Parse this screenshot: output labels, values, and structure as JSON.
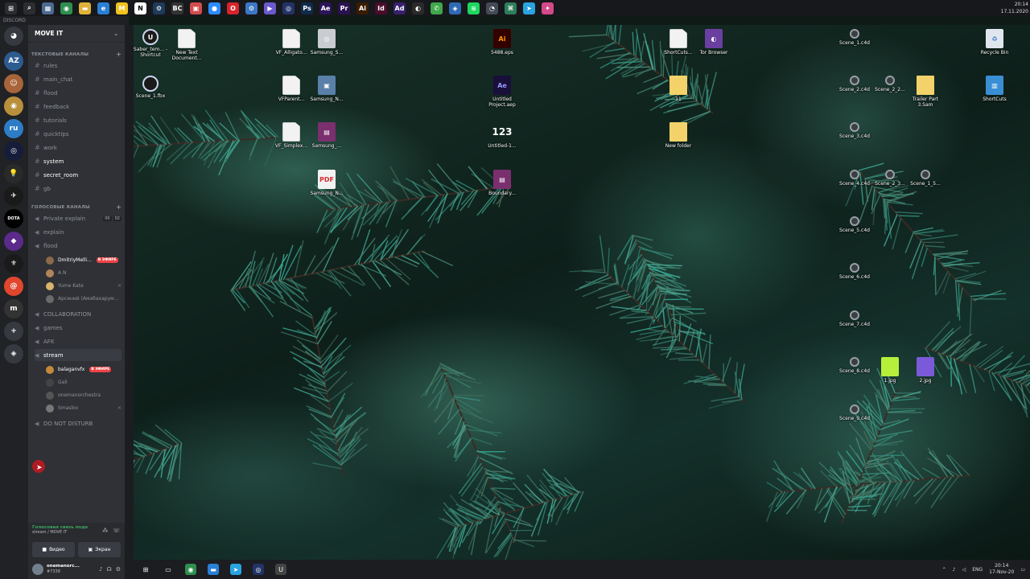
{
  "top_taskbar": {
    "icons": [
      {
        "name": "windows-start-icon",
        "color": "#2b2d31",
        "glyph": "⊞"
      },
      {
        "name": "search-icon",
        "color": "#2b2d31",
        "glyph": "⌕"
      },
      {
        "name": "calculator-icon",
        "color": "#4b6a90",
        "glyph": "▦"
      },
      {
        "name": "chrome-icon",
        "color": "#2f8f4e",
        "glyph": "◉"
      },
      {
        "name": "explorer-icon",
        "color": "#e0b23a",
        "glyph": "▬"
      },
      {
        "name": "edge-icon",
        "color": "#2a7fd4",
        "glyph": "e"
      },
      {
        "name": "miro-icon",
        "color": "#f3c21d",
        "glyph": "M"
      },
      {
        "name": "notion-icon",
        "color": "#ffffff",
        "glyph": "N"
      },
      {
        "name": "steam-icon",
        "color": "#1f3b5a",
        "glyph": "⚙"
      },
      {
        "name": "bc-icon",
        "color": "#333333",
        "glyph": "BC"
      },
      {
        "name": "app-red-icon",
        "color": "#d24c4c",
        "glyph": "▣"
      },
      {
        "name": "zoom-icon",
        "color": "#2d8cff",
        "glyph": "●"
      },
      {
        "name": "opera-icon",
        "color": "#d8242b",
        "glyph": "O"
      },
      {
        "name": "settings-icon",
        "color": "#3a78c4",
        "glyph": "⚙"
      },
      {
        "name": "play-icon",
        "color": "#6a5acd",
        "glyph": "▶"
      },
      {
        "name": "cinema4d-icon",
        "color": "#223366",
        "glyph": "◎"
      },
      {
        "name": "photoshop-icon",
        "color": "#0f2a4a",
        "glyph": "Ps"
      },
      {
        "name": "aftereffects-icon",
        "color": "#2b145a",
        "glyph": "Ae"
      },
      {
        "name": "premiere-icon",
        "color": "#2a1252",
        "glyph": "Pr"
      },
      {
        "name": "illustrator-icon",
        "color": "#3b1c00",
        "glyph": "Ai"
      },
      {
        "name": "indesign-icon",
        "color": "#4a0d2a",
        "glyph": "Id"
      },
      {
        "name": "adobe-icon",
        "color": "#38216e",
        "glyph": "Ad"
      },
      {
        "name": "obs-icon",
        "color": "#2a2a2a",
        "glyph": "◐"
      },
      {
        "name": "whatsapp-icon",
        "color": "#3ea84a",
        "glyph": "✆"
      },
      {
        "name": "app-blue-icon",
        "color": "#2f6ab6",
        "glyph": "◈"
      },
      {
        "name": "spotify-icon",
        "color": "#1ed760",
        "glyph": "≋"
      },
      {
        "name": "discord-taskbar-icon",
        "color": "#444a55",
        "glyph": "◔"
      },
      {
        "name": "app-grid-icon",
        "color": "#2e7d5b",
        "glyph": "⌘"
      },
      {
        "name": "telegram-icon",
        "color": "#2aa3e0",
        "glyph": "➤"
      },
      {
        "name": "app-multicolor-icon",
        "color": "#d34a8a",
        "glyph": "✦"
      }
    ],
    "clock_time": "20:14",
    "clock_date": "17.11.2020"
  },
  "discord": {
    "window_title": "DISCORD",
    "guild_name": "MOVE IT",
    "text_category": "ТЕКСТОВЫЕ КАНАЛЫ",
    "text_channels": [
      {
        "name": "rules",
        "unread": false
      },
      {
        "name": "main_chat",
        "unread": false
      },
      {
        "name": "flood",
        "unread": false
      },
      {
        "name": "feedback",
        "unread": false
      },
      {
        "name": "tutorials",
        "unread": false
      },
      {
        "name": "quicktips",
        "unread": false
      },
      {
        "name": "work",
        "unread": false
      },
      {
        "name": "system",
        "unread": true
      },
      {
        "name": "secret_room",
        "unread": true
      },
      {
        "name": "gb",
        "unread": false
      }
    ],
    "voice_category": "ГОЛОСОВЫЕ КАНАЛЫ",
    "voice_channels": [
      {
        "name": "Private explain",
        "counts": [
          "00",
          "02"
        ]
      },
      {
        "name": "explain"
      },
      {
        "name": "flood"
      },
      {
        "name": "COLLABORATION"
      },
      {
        "name": "games"
      },
      {
        "name": "AFK"
      },
      {
        "name": "stream"
      },
      {
        "name": "DO NOT DISTURB"
      }
    ],
    "flood_users": [
      {
        "name": "DmitriyMelli...",
        "live": "В ЭФИРЕ",
        "color": "#8a6a4a"
      },
      {
        "name": "A N",
        "color": "#b0845c"
      },
      {
        "name": "Yume Kate",
        "mic": "✕",
        "color": "#d9b36a"
      },
      {
        "name": "Арсений (Амабахарум...",
        "color": "#6a6a6a"
      }
    ],
    "stream_users": [
      {
        "name": "balaganvfx",
        "live": "В ЭФИРЕ",
        "color": "#c48a3a"
      },
      {
        "name": "Gali",
        "color": "#444444"
      },
      {
        "name": "onemanorchestra",
        "color": "#555555"
      },
      {
        "name": "Smaslov",
        "mic": "✕",
        "color": "#777777"
      }
    ],
    "voice_status_title": "Голосовая связь подк",
    "voice_status_sub": "stream / MOVE IT",
    "video_label": "Видео",
    "screen_label": "Экран",
    "user_name": "onemanorc...",
    "user_tag": "#7338",
    "servers": [
      {
        "name": "server-home",
        "glyph": "◕",
        "color": "#36393f"
      },
      {
        "name": "server-az",
        "glyph": "AZ",
        "color": "#2c5b8f"
      },
      {
        "name": "server-avatar",
        "glyph": "☺",
        "color": "#a8643a"
      },
      {
        "name": "server-gold",
        "glyph": "◉",
        "color": "#b88f3c"
      },
      {
        "name": "server-ru",
        "glyph": "ru",
        "color": "#2d7cc6"
      },
      {
        "name": "server-c4d",
        "glyph": "◎",
        "color": "#151d3a"
      },
      {
        "name": "server-bulb",
        "glyph": "💡",
        "color": "#2a2a2a"
      },
      {
        "name": "server-bird",
        "glyph": "✈",
        "color": "#1a1a1a"
      },
      {
        "name": "server-dota",
        "glyph": "DOTA",
        "color": "#000000"
      },
      {
        "name": "server-purple",
        "glyph": "◆",
        "color": "#5b2a8a"
      },
      {
        "name": "server-symbol",
        "glyph": "⚜",
        "color": "#1a1a1a"
      },
      {
        "name": "server-houdini",
        "glyph": "@",
        "color": "#e0472e"
      },
      {
        "name": "server-m",
        "glyph": "m",
        "color": "#333333"
      },
      {
        "name": "server-add",
        "glyph": "+",
        "color": "#36393f"
      },
      {
        "name": "server-explore",
        "glyph": "◈",
        "color": "#36393f"
      }
    ]
  },
  "desktop": {
    "icons": [
      {
        "name": "Saber_tem... - Shortcut",
        "kind": "ue"
      },
      {
        "name": "New Text Document...",
        "kind": "doc"
      },
      {
        "name": "Scene_1.fbx",
        "kind": "c4d"
      },
      {
        "name": "VF_Alligato...",
        "kind": "doc"
      },
      {
        "name": "Samsung_S...",
        "kind": "disk"
      },
      {
        "name": "VFParent...",
        "kind": "doc"
      },
      {
        "name": "Samsung_N...",
        "kind": "pc"
      },
      {
        "name": "VF_Simplex...",
        "kind": "doc"
      },
      {
        "name": "Samsung_...",
        "kind": "rar"
      },
      {
        "name": "Samsung_N...",
        "kind": "pdf"
      },
      {
        "name": "5488.eps",
        "kind": "ai"
      },
      {
        "name": "Untitled Project.aep",
        "kind": "ae"
      },
      {
        "name": "Untitled-1...",
        "kind": "num"
      },
      {
        "name": "Boundary...",
        "kind": "rar"
      },
      {
        "name": "ShortCuts...",
        "kind": "doc"
      },
      {
        "name": "Tor Browser",
        "kind": "tor"
      },
      {
        "name": "11",
        "kind": "folder"
      },
      {
        "name": "New folder",
        "kind": "folder"
      },
      {
        "name": "Scene_1.c4d",
        "kind": "c4d-small"
      },
      {
        "name": "Recycle Bin",
        "kind": "bin"
      },
      {
        "name": "Scene_2.c4d",
        "kind": "c4d-small"
      },
      {
        "name": "Scene_2_2...",
        "kind": "c4d-small"
      },
      {
        "name": "Trailer Part 3.Sam",
        "kind": "folder"
      },
      {
        "name": "ShortCuts",
        "kind": "shortcuts"
      },
      {
        "name": "Scene_3.c4d",
        "kind": "c4d-small"
      },
      {
        "name": "Scene_4.c4d",
        "kind": "c4d-small"
      },
      {
        "name": "Scene_2_3...",
        "kind": "c4d-small"
      },
      {
        "name": "Scene_1_5...",
        "kind": "c4d-small"
      },
      {
        "name": "Scene_5.c4d",
        "kind": "c4d-small"
      },
      {
        "name": "Scene_6.c4d",
        "kind": "c4d-small"
      },
      {
        "name": "Scene_7.c4d",
        "kind": "c4d-small"
      },
      {
        "name": "Scene_8.c4d",
        "kind": "c4d-small"
      },
      {
        "name": "1.jpg",
        "kind": "jpg-lime"
      },
      {
        "name": "2.jpg",
        "kind": "jpg-purple"
      },
      {
        "name": "Scene_9.c4d",
        "kind": "c4d-small"
      }
    ]
  },
  "bottom_taskbar": {
    "apps": [
      {
        "name": "start-icon",
        "glyph": "⊞",
        "color": "#1b1d21"
      },
      {
        "name": "task-view-icon",
        "glyph": "▭",
        "color": "#1b1d21"
      },
      {
        "name": "chrome-icon",
        "glyph": "◉",
        "color": "#2f8f4e"
      },
      {
        "name": "explorer-icon",
        "glyph": "▬",
        "color": "#2a7fd4"
      },
      {
        "name": "telegram-icon",
        "glyph": "➤",
        "color": "#2aa3e0"
      },
      {
        "name": "cinema4d-icon",
        "glyph": "◎",
        "color": "#223366"
      },
      {
        "name": "unreal-icon",
        "glyph": "U",
        "color": "#444444"
      }
    ],
    "lang": "ENG",
    "time": "20:14",
    "date": "17-Nov-20"
  }
}
